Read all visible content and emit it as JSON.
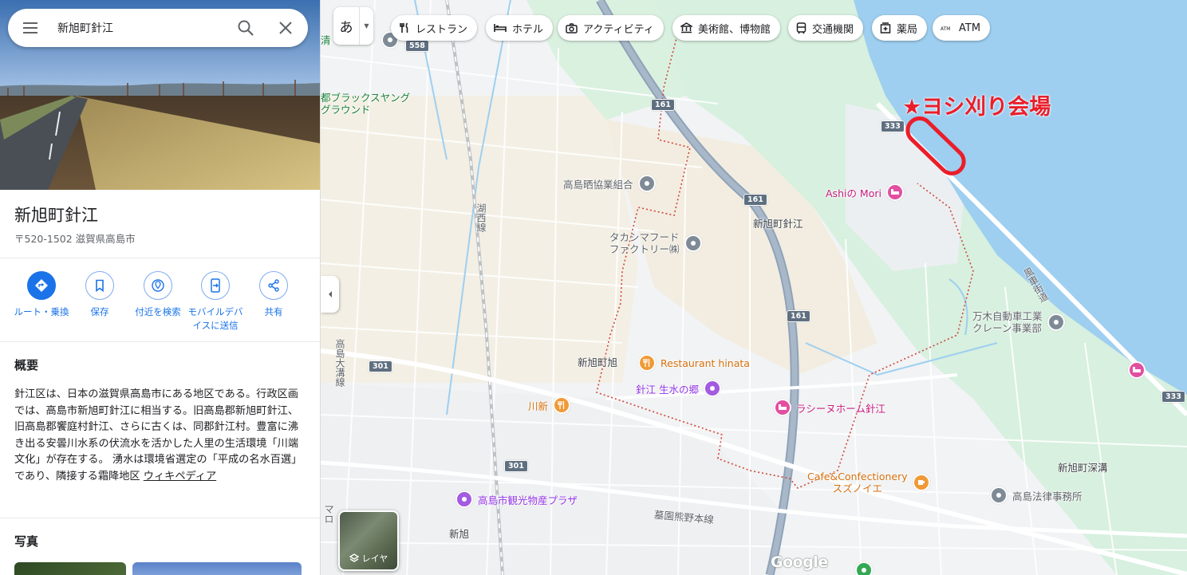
{
  "search": {
    "query": "新旭町針江"
  },
  "place": {
    "title": "新旭町針江",
    "address": "〒520-1502 滋賀県高島市"
  },
  "actions": [
    {
      "label": "ルート・乗換",
      "icon": "directions-icon"
    },
    {
      "label": "保存",
      "icon": "bookmark-icon"
    },
    {
      "label": "付近を検索",
      "icon": "nearby-icon"
    },
    {
      "label": "モバイルデバイスに送信",
      "icon": "send-to-phone-icon"
    },
    {
      "label": "共有",
      "icon": "share-icon"
    }
  ],
  "overview": {
    "heading": "概要",
    "text": "針江区は、日本の滋賀県高島市にある地区である。行政区画では、高島市新旭町針江に相当する。旧高島郡新旭町針江、旧高島郡饗庭村針江、さらに古くは、同郡針江村。豊富に沸き出る安曇川水系の伏流水を活かした人里の生活環境「川端文化」が存在する。 湧水は環境省選定の「平成の名水百選」であり、隣接する霜降地区 ",
    "link": "ウィキペディア"
  },
  "photos": {
    "heading": "写真"
  },
  "map": {
    "lang_button": "あ",
    "chips": [
      {
        "label": "レストラン",
        "icon": "fork-knife-icon"
      },
      {
        "label": "ホテル",
        "icon": "bed-icon"
      },
      {
        "label": "アクティビティ",
        "icon": "camera-icon"
      },
      {
        "label": "美術館、博物館",
        "icon": "museum-icon"
      },
      {
        "label": "交通機関",
        "icon": "train-icon"
      },
      {
        "label": "薬局",
        "icon": "pharmacy-icon"
      },
      {
        "label": "ATM",
        "icon": "atm-icon"
      }
    ],
    "layer_label": "レイヤ",
    "annotation": "ヨシ刈り会場",
    "annotation_star": "★",
    "google": "Google",
    "places": [
      {
        "name": "高島晒協業組合",
        "type": "business"
      },
      {
        "name": "タカシマフード\nファクトリー㈱",
        "type": "business"
      },
      {
        "name": "Restaurant hinata",
        "type": "restaurant"
      },
      {
        "name": "針江 生水の郷",
        "type": "attraction"
      },
      {
        "name": "川新",
        "type": "restaurant"
      },
      {
        "name": "ラシーヌホーム針江",
        "type": "lodging"
      },
      {
        "name": "Cafe&Confectionery\nスズノイエ",
        "type": "cafe"
      },
      {
        "name": "高島市観光物産プラザ",
        "type": "attraction"
      },
      {
        "name": "Ashiの Mori",
        "type": "lodging"
      },
      {
        "name": "万木自動車工業\nクレーン事業部",
        "type": "business"
      },
      {
        "name": "高島法律事務所",
        "type": "business"
      }
    ],
    "area_labels": {
      "harie": "新旭町針江",
      "shinasahi_cho": "新旭町旭",
      "fukamizo": "新旭町深溝",
      "shinasahi": "新旭",
      "ground": "都ブラックスヤング\nグラウンド",
      "kiyo": "清",
      "mar": "マロ"
    },
    "roads": {
      "r161a": "161",
      "r161b": "161",
      "r161c": "161",
      "r333a": "333",
      "r333b": "333",
      "r301a": "301",
      "r301b": "301",
      "r558": "558",
      "kohoku": "湖西線",
      "kosei_ave": "高島大溝線",
      "fuhen": "風車街道",
      "zeni": "墓園熊野本線"
    }
  }
}
